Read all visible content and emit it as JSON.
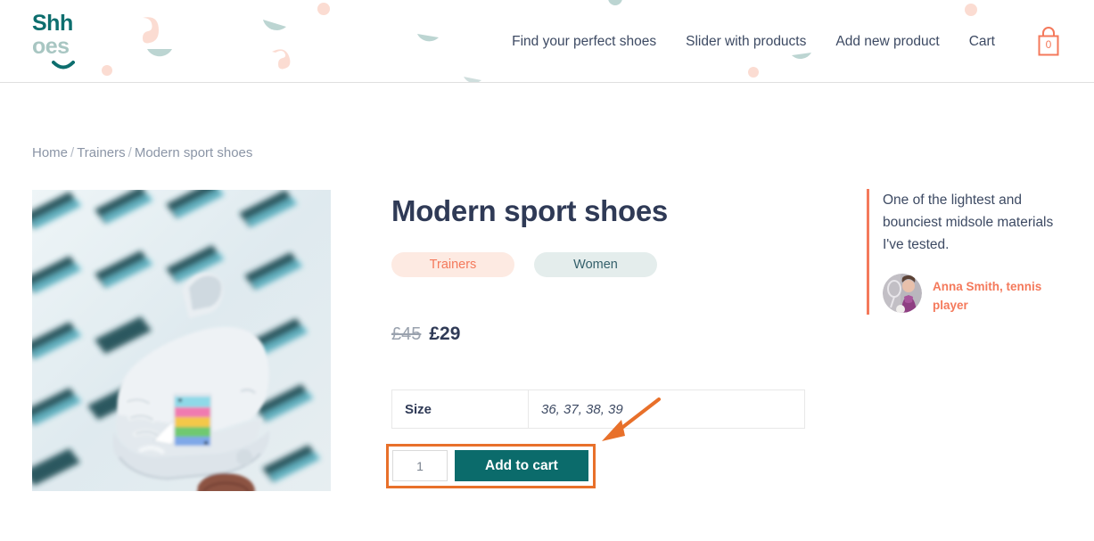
{
  "brand": {
    "logo_top": "Shh",
    "logo_bottom": "oes",
    "logo_icon": "smile-curve-icon"
  },
  "header": {
    "nav": [
      {
        "label": "Find your perfect shoes"
      },
      {
        "label": "Slider with products"
      },
      {
        "label": "Add new product"
      },
      {
        "label": "Cart"
      }
    ],
    "cart": {
      "icon": "shopping-bag-icon",
      "count": "0"
    }
  },
  "breadcrumb": {
    "items": [
      {
        "label": "Home"
      },
      {
        "label": "Trainers"
      },
      {
        "label": "Modern sport shoes"
      }
    ],
    "separator": "/"
  },
  "product": {
    "image_alt": "white sneaker held in hand against blurred building facade",
    "title": "Modern sport shoes",
    "tags": [
      {
        "label": "Trainers",
        "style": "peach"
      },
      {
        "label": "Women",
        "style": "teal"
      }
    ],
    "price": {
      "old": "£45",
      "current": "£29"
    },
    "attributes": {
      "rows": [
        {
          "name": "Size",
          "value": "36, 37, 38, 39"
        }
      ]
    },
    "cart_form": {
      "quantity_value": "1",
      "quantity_placeholder": "1",
      "submit_label": "Add to cart"
    }
  },
  "testimonial": {
    "quote": "One of the lightest and bounciest midsole materials I've tested.",
    "author": "Anna Smith, tennis player",
    "avatar_alt": "tennis player holding racket"
  },
  "annotations": {
    "highlight_target": "add-to-cart-form",
    "arrow_direction": "down-left"
  },
  "colors": {
    "brand_teal": "#0d6e6e",
    "brand_teal_light": "#a8c6c2",
    "accent_coral": "#f4795b",
    "button_teal": "#0b6b6b",
    "text_dark": "#2f3a56",
    "text_muted": "#8b95a6",
    "annotation_orange": "#e8702a"
  }
}
